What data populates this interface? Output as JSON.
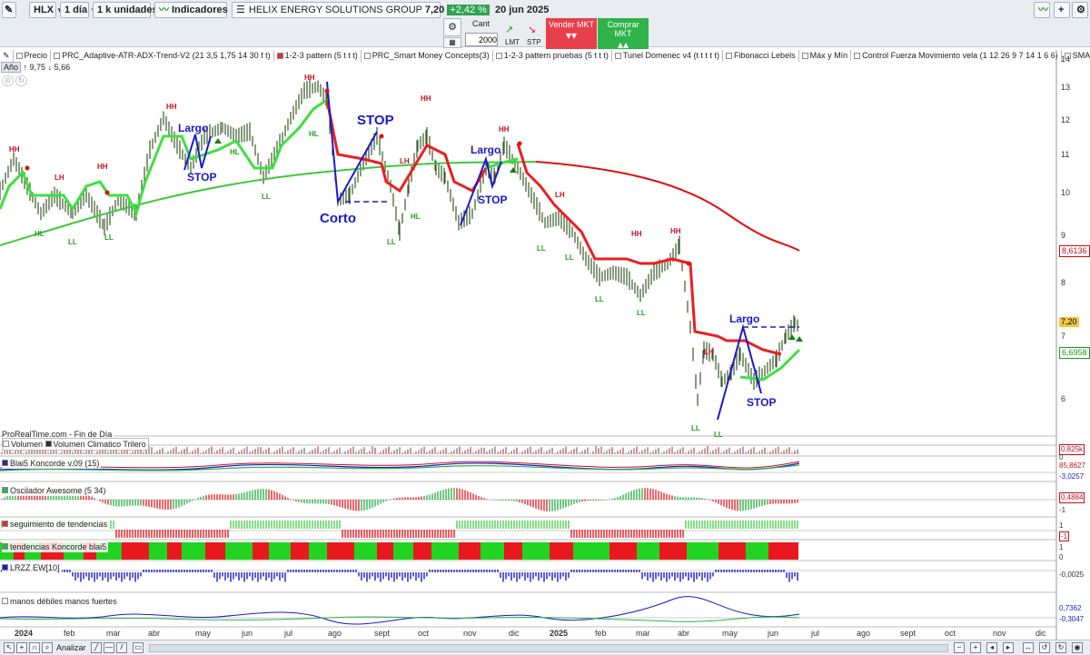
{
  "toolbar": {
    "symbol": "HLX",
    "period": "1 día",
    "units": "1 k unidades",
    "indicators": "Indicadores",
    "company": "HELIX ENERGY SOLUTIONS GROUP",
    "last_price": "7,20",
    "change": "+2,42 %",
    "date": "20 jun 2025",
    "qty_label": "Cant",
    "qty_value": "2000",
    "lmt": "LMT",
    "stp": "STP",
    "sell": "Vender MKT",
    "buy": "Comprar MKT"
  },
  "legend": [
    "Precio",
    "PRC_Adaptive-ATR-ADX-Trend-V2 (21 3,5 1,75 14 30 f t)",
    "1-2-3 pattern (5 t t t)",
    "PRC_Smart Money Concepts(3)",
    "1-2-3 pattern pruebas (5 t t t)",
    "Tunel Domenec v4 (t t t t t)",
    "Fibonacci Lebels",
    "Máx y Mín",
    "Control Fuerza Movimiento vela (1 12 26 9 7 14 1 6 6)",
    "SMA (30)"
  ],
  "year_sel": "Año",
  "hi_label": "9,75",
  "lo_label": "5,66",
  "provider": "ProRealTime.com - Fin de Día",
  "panels": {
    "volume": [
      "Volumen",
      "Volumen Climatico Trilero"
    ],
    "koncorde": "Blai5 Koncorde v.09 (15)",
    "awesome": "Oscilador Awesome (5 34)",
    "seguimiento": "seguimiento de tendencias",
    "tendencias": "tendencias Koncorde blai5",
    "lrzz": "LRZZ EW[10]",
    "manos": "manos débiles  manos fuertes"
  },
  "y_axis": [
    "14",
    "13",
    "12",
    "11",
    "10",
    "9",
    "8",
    "7",
    "6"
  ],
  "price_tags": {
    "sma": "8,6136",
    "last": "7,20",
    "stop": "6,6958"
  },
  "ind_axis": {
    "vol": "0,825k",
    "vol0": "0",
    "k1": "85,8627",
    "k2": "-3,0257",
    "ao": "0,4884",
    "ao1": "-1",
    "seg1": "1",
    "seg2": "-1",
    "tk1": "1",
    "tk2": "0",
    "lrzz": "-0,0025",
    "mf1": "0,7362",
    "mf2": "-0,3047"
  },
  "months": [
    "2024",
    "feb",
    "mar",
    "abr",
    "may",
    "jun",
    "jul",
    "ago",
    "sept",
    "oct",
    "nov",
    "dic",
    "2025",
    "feb",
    "mar",
    "abr",
    "may",
    "jun",
    "jul",
    "ago",
    "sept",
    "oct",
    "nov",
    "dic"
  ],
  "annotations": {
    "hh": "HH",
    "lh": "LH",
    "hl": "HL",
    "ll": "LL",
    "largo": "Largo",
    "stop": "STOP",
    "corto": "Corto",
    "stop_big": "STOP",
    "one": "1"
  },
  "bottom": {
    "analyze": "Analizar"
  },
  "colors": {
    "up": "#22c322",
    "down": "#e8282e",
    "sma": "#3ec93e",
    "ma_long": "#e01010",
    "zig": "#1a1ac8",
    "candle": "#3a5a2a"
  }
}
